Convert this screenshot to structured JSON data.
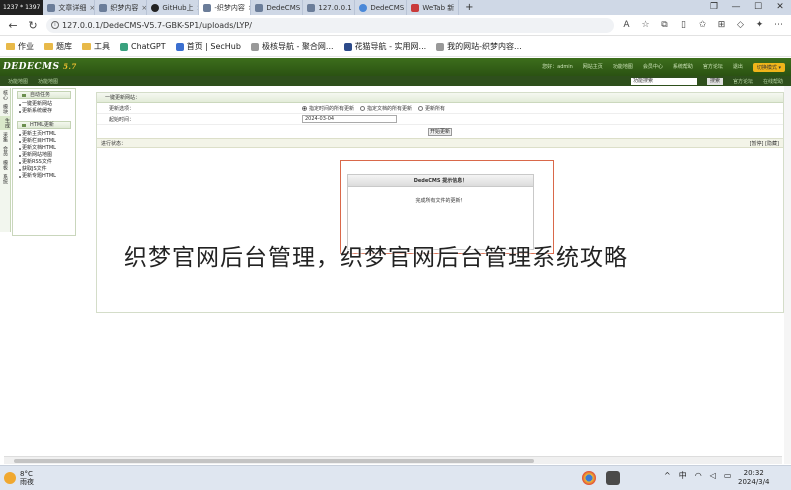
{
  "screen_dims": "1237 * 1397",
  "tabs": [
    {
      "label": "文章详细"
    },
    {
      "label": "织梦内容"
    },
    {
      "label": "GitHub上"
    },
    {
      "label": "-织梦内容"
    },
    {
      "label": "DedeCMS"
    },
    {
      "label": "127.0.0.1"
    },
    {
      "label": "DedeCMS"
    },
    {
      "label": "WeTab 新"
    }
  ],
  "url": "127.0.0.1/DedeCMS-V5.7-GBK-SP1/uploads/LYP/",
  "bookmarks": [
    "作业",
    "题库",
    "工具",
    "ChatGPT",
    "首页 | SecHub",
    "极核导航 - 聚合网...",
    "花猫导航 - 实用网...",
    "我的网站-织梦内容..."
  ],
  "dede": {
    "logo": "DEDECMS",
    "logo_ver": "5.7",
    "top_links": [
      "您好：admin",
      "网站主页",
      "功能地图",
      "会员中心",
      "系统帮助",
      "官方论坛",
      "退出"
    ],
    "mode_btn": "切换模式 ▾",
    "sub_left": [
      "功能地图",
      "功能地图"
    ],
    "search_placeholder": "功能搜索",
    "search_btn": "搜索",
    "sub_right": [
      "官方论坛",
      "在线帮助"
    ]
  },
  "left_tabs": [
    "核心",
    "模块",
    "生成",
    "采集",
    "会员",
    "模板",
    "系统"
  ],
  "side": {
    "g1": "自动任务",
    "g1_items": [
      "一键更新网站",
      "更新系统缓存"
    ],
    "g2": "HTML更新",
    "g2_items": [
      "更新主页HTML",
      "更新栏目HTML",
      "更新文档HTML",
      "更新网站地图",
      "更新RSS文件",
      "获取JS文件",
      "更新专题HTML"
    ]
  },
  "panel": {
    "title": "一键更新网站：",
    "row1_label": "更新选项：",
    "opt1": "指定时间的所有更新",
    "opt2": "指定文档的所有更新",
    "opt3": "更新所有",
    "row2_label": "起始时间：",
    "date_value": "2024-03-04",
    "start_btn": "开始更新",
    "status_label": "进行状态：",
    "status_right": "[暂停]  [隐藏]"
  },
  "popup": {
    "title": "DedeCMS 提示信息！",
    "message": "完成所有文件的更新！"
  },
  "caption": "织梦官网后台管理，织梦官网后台管理系统攻略",
  "taskbar": {
    "temp": "8°C",
    "weather": "雨夜",
    "ime": "中",
    "time": "20:32",
    "date": "2024/3/4"
  }
}
